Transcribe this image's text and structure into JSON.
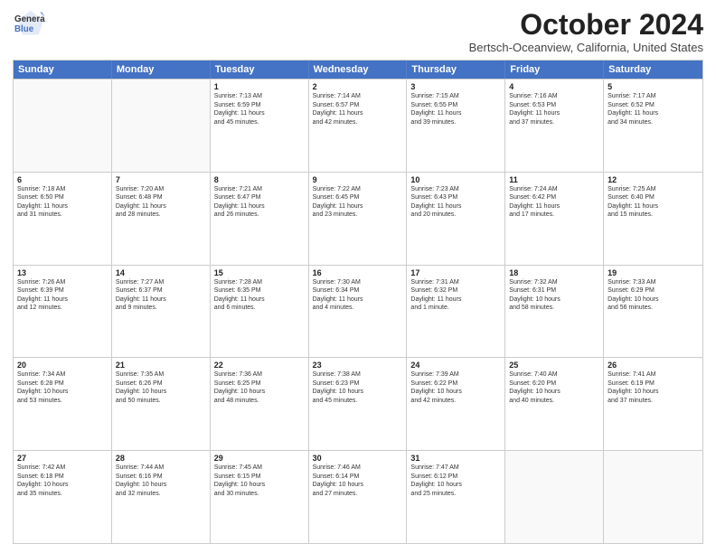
{
  "logo": {
    "text_line1": "General",
    "text_line2": "Blue"
  },
  "header": {
    "month_title": "October 2024",
    "subtitle": "Bertsch-Oceanview, California, United States"
  },
  "days_of_week": [
    "Sunday",
    "Monday",
    "Tuesday",
    "Wednesday",
    "Thursday",
    "Friday",
    "Saturday"
  ],
  "rows": [
    {
      "cells": [
        {
          "day": "",
          "empty": true,
          "lines": []
        },
        {
          "day": "",
          "empty": true,
          "lines": []
        },
        {
          "day": "1",
          "lines": [
            "Sunrise: 7:13 AM",
            "Sunset: 6:59 PM",
            "Daylight: 11 hours",
            "and 45 minutes."
          ]
        },
        {
          "day": "2",
          "lines": [
            "Sunrise: 7:14 AM",
            "Sunset: 6:57 PM",
            "Daylight: 11 hours",
            "and 42 minutes."
          ]
        },
        {
          "day": "3",
          "lines": [
            "Sunrise: 7:15 AM",
            "Sunset: 6:55 PM",
            "Daylight: 11 hours",
            "and 39 minutes."
          ]
        },
        {
          "day": "4",
          "lines": [
            "Sunrise: 7:16 AM",
            "Sunset: 6:53 PM",
            "Daylight: 11 hours",
            "and 37 minutes."
          ]
        },
        {
          "day": "5",
          "lines": [
            "Sunrise: 7:17 AM",
            "Sunset: 6:52 PM",
            "Daylight: 11 hours",
            "and 34 minutes."
          ]
        }
      ]
    },
    {
      "cells": [
        {
          "day": "6",
          "lines": [
            "Sunrise: 7:18 AM",
            "Sunset: 6:50 PM",
            "Daylight: 11 hours",
            "and 31 minutes."
          ]
        },
        {
          "day": "7",
          "lines": [
            "Sunrise: 7:20 AM",
            "Sunset: 6:48 PM",
            "Daylight: 11 hours",
            "and 28 minutes."
          ]
        },
        {
          "day": "8",
          "lines": [
            "Sunrise: 7:21 AM",
            "Sunset: 6:47 PM",
            "Daylight: 11 hours",
            "and 26 minutes."
          ]
        },
        {
          "day": "9",
          "lines": [
            "Sunrise: 7:22 AM",
            "Sunset: 6:45 PM",
            "Daylight: 11 hours",
            "and 23 minutes."
          ]
        },
        {
          "day": "10",
          "lines": [
            "Sunrise: 7:23 AM",
            "Sunset: 6:43 PM",
            "Daylight: 11 hours",
            "and 20 minutes."
          ]
        },
        {
          "day": "11",
          "lines": [
            "Sunrise: 7:24 AM",
            "Sunset: 6:42 PM",
            "Daylight: 11 hours",
            "and 17 minutes."
          ]
        },
        {
          "day": "12",
          "lines": [
            "Sunrise: 7:25 AM",
            "Sunset: 6:40 PM",
            "Daylight: 11 hours",
            "and 15 minutes."
          ]
        }
      ]
    },
    {
      "cells": [
        {
          "day": "13",
          "lines": [
            "Sunrise: 7:26 AM",
            "Sunset: 6:39 PM",
            "Daylight: 11 hours",
            "and 12 minutes."
          ]
        },
        {
          "day": "14",
          "lines": [
            "Sunrise: 7:27 AM",
            "Sunset: 6:37 PM",
            "Daylight: 11 hours",
            "and 9 minutes."
          ]
        },
        {
          "day": "15",
          "lines": [
            "Sunrise: 7:28 AM",
            "Sunset: 6:35 PM",
            "Daylight: 11 hours",
            "and 6 minutes."
          ]
        },
        {
          "day": "16",
          "lines": [
            "Sunrise: 7:30 AM",
            "Sunset: 6:34 PM",
            "Daylight: 11 hours",
            "and 4 minutes."
          ]
        },
        {
          "day": "17",
          "lines": [
            "Sunrise: 7:31 AM",
            "Sunset: 6:32 PM",
            "Daylight: 11 hours",
            "and 1 minute."
          ]
        },
        {
          "day": "18",
          "lines": [
            "Sunrise: 7:32 AM",
            "Sunset: 6:31 PM",
            "Daylight: 10 hours",
            "and 58 minutes."
          ]
        },
        {
          "day": "19",
          "lines": [
            "Sunrise: 7:33 AM",
            "Sunset: 6:29 PM",
            "Daylight: 10 hours",
            "and 56 minutes."
          ]
        }
      ]
    },
    {
      "cells": [
        {
          "day": "20",
          "lines": [
            "Sunrise: 7:34 AM",
            "Sunset: 6:28 PM",
            "Daylight: 10 hours",
            "and 53 minutes."
          ]
        },
        {
          "day": "21",
          "lines": [
            "Sunrise: 7:35 AM",
            "Sunset: 6:26 PM",
            "Daylight: 10 hours",
            "and 50 minutes."
          ]
        },
        {
          "day": "22",
          "lines": [
            "Sunrise: 7:36 AM",
            "Sunset: 6:25 PM",
            "Daylight: 10 hours",
            "and 48 minutes."
          ]
        },
        {
          "day": "23",
          "lines": [
            "Sunrise: 7:38 AM",
            "Sunset: 6:23 PM",
            "Daylight: 10 hours",
            "and 45 minutes."
          ]
        },
        {
          "day": "24",
          "lines": [
            "Sunrise: 7:39 AM",
            "Sunset: 6:22 PM",
            "Daylight: 10 hours",
            "and 42 minutes."
          ]
        },
        {
          "day": "25",
          "lines": [
            "Sunrise: 7:40 AM",
            "Sunset: 6:20 PM",
            "Daylight: 10 hours",
            "and 40 minutes."
          ]
        },
        {
          "day": "26",
          "lines": [
            "Sunrise: 7:41 AM",
            "Sunset: 6:19 PM",
            "Daylight: 10 hours",
            "and 37 minutes."
          ]
        }
      ]
    },
    {
      "cells": [
        {
          "day": "27",
          "lines": [
            "Sunrise: 7:42 AM",
            "Sunset: 6:18 PM",
            "Daylight: 10 hours",
            "and 35 minutes."
          ]
        },
        {
          "day": "28",
          "lines": [
            "Sunrise: 7:44 AM",
            "Sunset: 6:16 PM",
            "Daylight: 10 hours",
            "and 32 minutes."
          ]
        },
        {
          "day": "29",
          "lines": [
            "Sunrise: 7:45 AM",
            "Sunset: 6:15 PM",
            "Daylight: 10 hours",
            "and 30 minutes."
          ]
        },
        {
          "day": "30",
          "lines": [
            "Sunrise: 7:46 AM",
            "Sunset: 6:14 PM",
            "Daylight: 10 hours",
            "and 27 minutes."
          ]
        },
        {
          "day": "31",
          "lines": [
            "Sunrise: 7:47 AM",
            "Sunset: 6:12 PM",
            "Daylight: 10 hours",
            "and 25 minutes."
          ]
        },
        {
          "day": "",
          "empty": true,
          "lines": []
        },
        {
          "day": "",
          "empty": true,
          "lines": []
        }
      ]
    }
  ]
}
